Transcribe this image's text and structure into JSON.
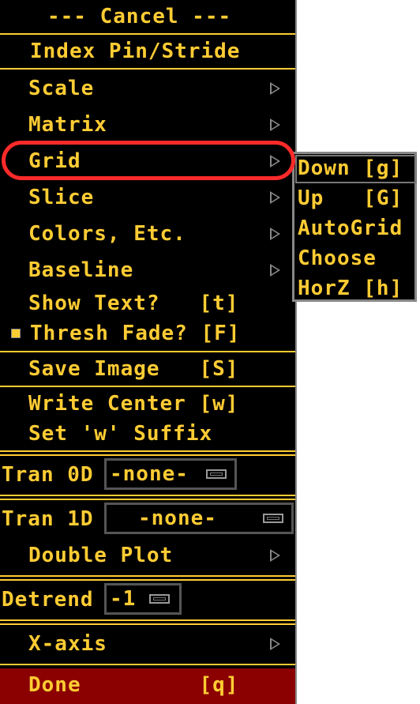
{
  "menu": {
    "cancel_label": "--- Cancel ---",
    "index_label": "Index Pin/Stride",
    "scale_label": "Scale",
    "matrix_label": "Matrix",
    "grid_label": "Grid",
    "slice_label": "Slice",
    "colors_label": "Colors, Etc.",
    "baseline_label": "Baseline",
    "show_text_label": "Show Text?   [t]",
    "thresh_fade_label": "Thresh Fade? [F]",
    "save_image_label": "Save Image   [S]",
    "write_center_label": "Write Center [w]",
    "set_suffix_label": "Set 'w' Suffix",
    "tran0d_label": "Tran 0D",
    "tran0d_value": "-none-",
    "tran1d_label": "Tran 1D",
    "tran1d_value": "-none-",
    "double_plot_label": "Double Plot",
    "detrend_label": "Detrend",
    "detrend_value": "-1",
    "xaxis_label": "X-axis",
    "done_label": "Done         [q]"
  },
  "submenu": {
    "down_label": "Down [g]",
    "up_label": "Up   [G]",
    "autogrid_label": "AutoGrid",
    "choose_label": "Choose",
    "horz_label": "HorZ [h]"
  },
  "colors": {
    "text": "#ffcc33",
    "background": "#000000",
    "done_bg": "#8b0000",
    "highlight": "#ff2a2a"
  }
}
